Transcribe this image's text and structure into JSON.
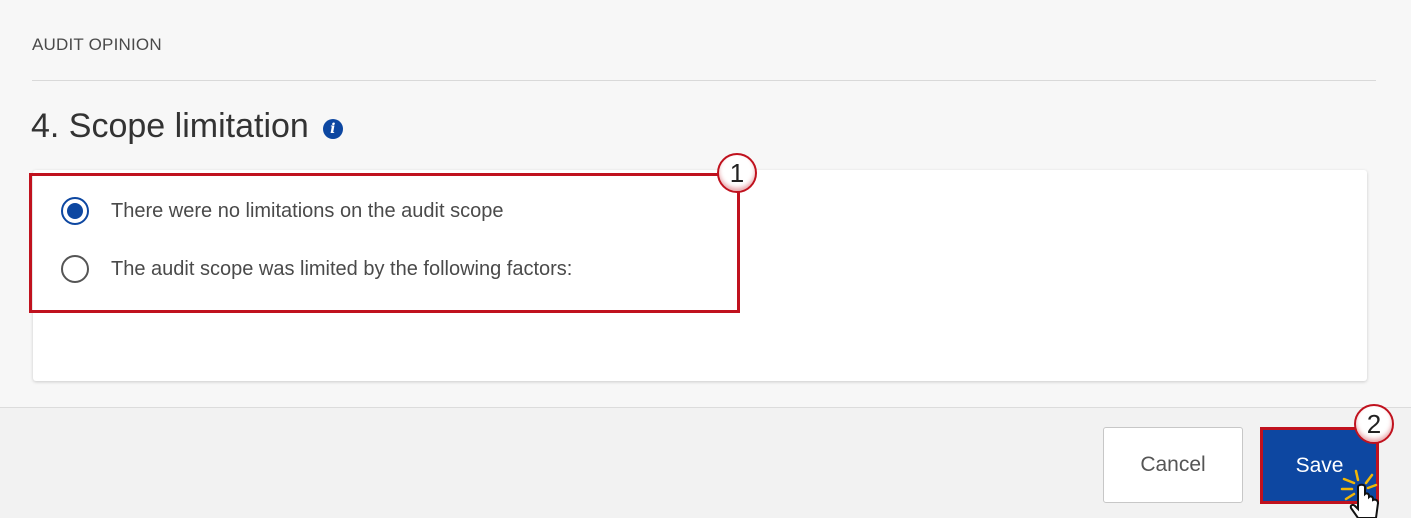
{
  "section_header": "AUDIT OPINION",
  "section_title": "4. Scope limitation",
  "info_icon_glyph": "i",
  "radio_options": [
    {
      "label": "There were no limitations on the audit scope",
      "selected": true
    },
    {
      "label": "The audit scope was limited by the following factors:",
      "selected": false
    }
  ],
  "callouts": [
    "1",
    "2"
  ],
  "buttons": {
    "cancel": "Cancel",
    "save": "Save"
  },
  "colors": {
    "primary": "#0d47a1",
    "highlight": "#c0121e"
  },
  "icons": {
    "info": "info-icon",
    "cursor": "hand-pointer-cursor-icon"
  }
}
